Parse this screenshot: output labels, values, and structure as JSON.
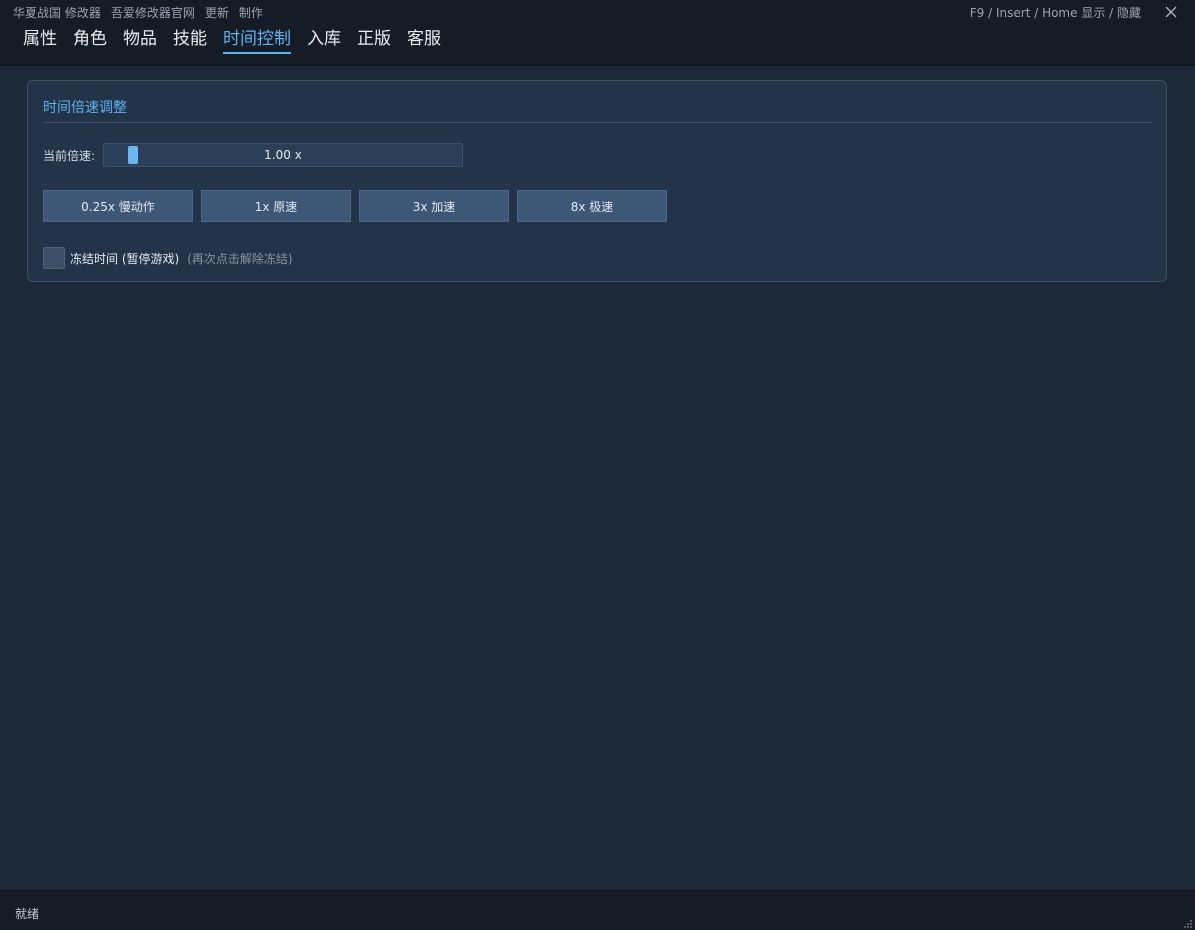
{
  "menu": {
    "items": [
      "华夏战国 修改器",
      "吾爱修改器官网",
      "更新",
      "制作"
    ]
  },
  "hotkey_hint": "F9 / Insert / Home  显示 / 隐藏",
  "tabs": [
    {
      "label": "属性",
      "active": false
    },
    {
      "label": "角色",
      "active": false
    },
    {
      "label": "物品",
      "active": false
    },
    {
      "label": "技能",
      "active": false
    },
    {
      "label": "时间控制",
      "active": true
    },
    {
      "label": "入库",
      "active": false
    },
    {
      "label": "正版",
      "active": false
    },
    {
      "label": "客服",
      "active": false
    }
  ],
  "group": {
    "title": "时间倍速调整",
    "speed_label": "当前倍速:",
    "speed_value": "1.00 x",
    "speed_slider_fraction": 0.07,
    "presets": [
      "0.25x 慢动作",
      "1x 原速",
      "3x 加速",
      "8x 极速"
    ],
    "freeze_label": "冻结时间 (暂停游戏)",
    "freeze_hint": "(再次点击解除冻结)",
    "freeze_checked": false
  },
  "status": {
    "text": "就绪"
  },
  "colors": {
    "accent": "#5bb4f0",
    "background": "#1d2838",
    "panel": "#233348",
    "button": "#3d5877",
    "bar": "#161c26"
  },
  "icons": {
    "close": "close-icon",
    "resize": "resize-grip-icon"
  }
}
